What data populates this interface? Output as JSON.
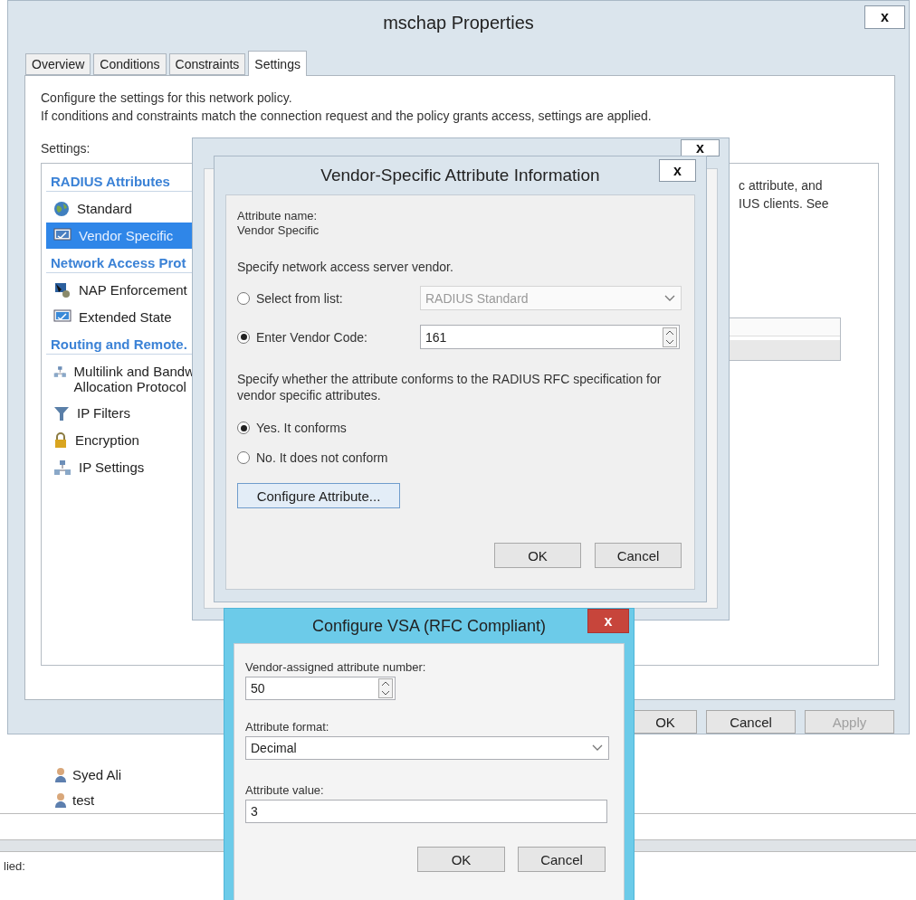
{
  "background_window": {
    "list_items": [
      {
        "label": "Syed Ali"
      },
      {
        "label": "test"
      }
    ],
    "status_text": "lied:"
  },
  "properties_window": {
    "title": "mschap Properties",
    "close": "x",
    "tabs": [
      {
        "label": "Overview",
        "selected": false
      },
      {
        "label": "Conditions",
        "selected": false
      },
      {
        "label": "Constraints",
        "selected": false
      },
      {
        "label": "Settings",
        "selected": true
      }
    ],
    "description": [
      "Configure the settings for this network policy.",
      "If conditions and constraints match the connection request and the policy grants access, settings are applied."
    ],
    "settings_label": "Settings:",
    "settings_tree": [
      {
        "kind": "group",
        "label": "RADIUS Attributes"
      },
      {
        "kind": "item",
        "label": "Standard",
        "selected": false
      },
      {
        "kind": "item",
        "label": "Vendor Specific",
        "selected": true
      },
      {
        "kind": "group",
        "label": "Network Access Prot"
      },
      {
        "kind": "item",
        "label": "NAP Enforcement",
        "selected": false
      },
      {
        "kind": "item",
        "label": "Extended State",
        "selected": false
      },
      {
        "kind": "group",
        "label": "Routing and Remote."
      },
      {
        "kind": "item",
        "label": "Multilink and Bandw",
        "label_2": "Allocation Protocol",
        "selected": false
      },
      {
        "kind": "item",
        "label": "IP Filters",
        "selected": false
      },
      {
        "kind": "item",
        "label": "Encryption",
        "selected": false
      },
      {
        "kind": "item",
        "label": "IP Settings",
        "selected": false
      }
    ],
    "right_text": [
      "c attribute, and",
      "IUS clients. See"
    ],
    "buttons": [
      {
        "label": "OK",
        "disabled": false
      },
      {
        "label": "Cancel",
        "disabled": false
      },
      {
        "label": "Apply",
        "disabled": true
      }
    ]
  },
  "attribute_dialog": {
    "close": "x"
  },
  "vendor_dialog": {
    "title": "Vendor-Specific Attribute Information",
    "close": "x",
    "attribute_name_label": "Attribute name:",
    "attribute_name": "Vendor Specific",
    "vendor_prompt": "Specify network access server vendor.",
    "vendor_options": [
      {
        "kind": "select",
        "label": "Select from list:",
        "selected": false,
        "value": "RADIUS Standard",
        "disabled": true
      },
      {
        "kind": "spin",
        "label": "Enter Vendor Code:",
        "selected": true,
        "value": "161",
        "disabled": false
      }
    ],
    "conform_prompt": "Specify whether the attribute conforms to the RADIUS RFC specification for vendor specific attributes.",
    "conform_options": [
      {
        "label": "Yes. It conforms",
        "selected": true
      },
      {
        "label": "No. It does not conform",
        "selected": false
      }
    ],
    "configure_button": "Configure Attribute...",
    "buttons": [
      "OK",
      "Cancel"
    ]
  },
  "vsa_dialog": {
    "title": "Configure VSA (RFC Compliant)",
    "close": "x",
    "number_label": "Vendor-assigned attribute number:",
    "number_value": "50",
    "format_label": "Attribute format:",
    "format_value": "Decimal",
    "value_label": "Attribute value:",
    "value": "3",
    "buttons": [
      "OK",
      "Cancel"
    ]
  }
}
